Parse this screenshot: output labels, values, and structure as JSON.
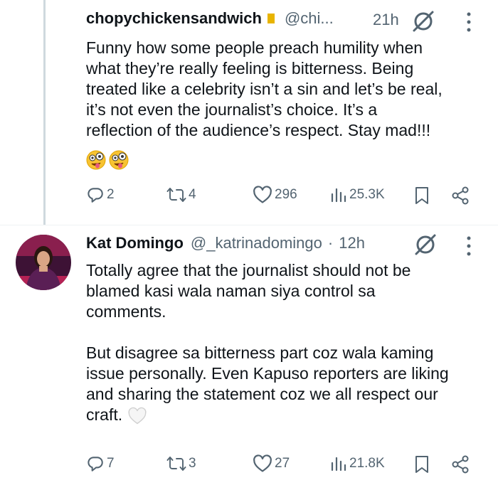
{
  "tweet1": {
    "name_cut": "chopychickensandwich",
    "handle_cut": "@chi...",
    "time": "21h",
    "text": "Funny how some people preach humility when\nwhat they’re really feeling is bitterness. Being\ntreated like a celebrity isn’t a sin and let’s be real,\nit’s not even the journalist’s choice. It’s a\nreflection of the audience’s respect. Stay mad!!!",
    "emojis": "zany-face x2",
    "replies": "2",
    "reposts": "4",
    "likes": "296",
    "views": "25.3K"
  },
  "tweet2": {
    "name": "Kat Domingo",
    "handle": "@_katrinadomingo",
    "dot": "·",
    "time": "12h",
    "text": "Totally agree that the journalist should not be\nblamed kasi wala naman siya control sa\ncomments.\n\nBut disagree sa bitterness part coz wala kaming\nissue personally. Even Kapuso reporters are liking\nand sharing the statement coz we all respect our\ncraft.",
    "emoji": "white-heart",
    "replies": "7",
    "reposts": "3",
    "likes": "27",
    "views": "21.8K"
  },
  "colors": {
    "text": "#0f1419",
    "secondary": "#536471",
    "thread": "#cfd9de"
  },
  "icons": [
    "reply-icon",
    "repost-icon",
    "like-icon",
    "views-icon",
    "bookmark-icon",
    "share-icon",
    "grok-icon",
    "more-icon"
  ]
}
